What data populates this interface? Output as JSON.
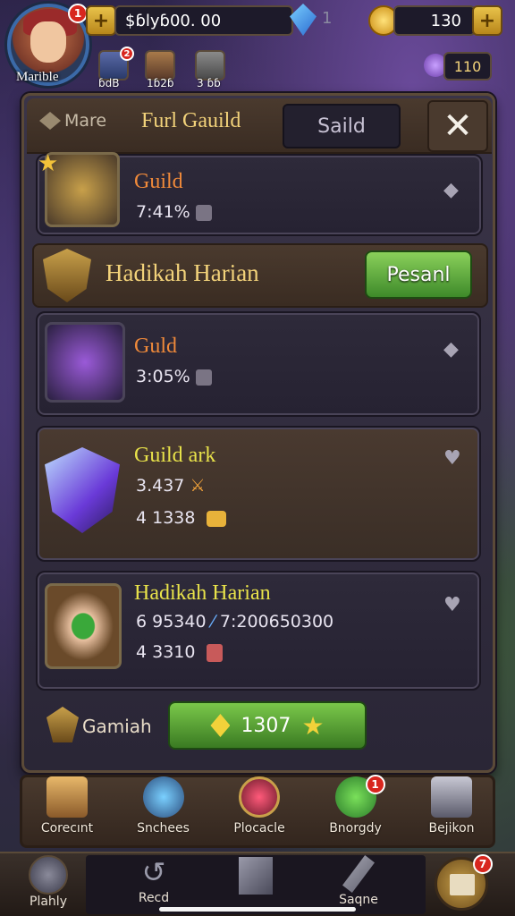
{
  "hud": {
    "player_name": "Marible",
    "avatar_badge": "1",
    "resource_value": "$ɓlyɓ00. 00",
    "gem_count": "1",
    "coin_count": "130",
    "shop_count": "110",
    "heroes": [
      {
        "label": "ɓdB",
        "badge": "2"
      },
      {
        "label": "1ɓ2ɓ"
      },
      {
        "label": "3 ɓɓ"
      }
    ]
  },
  "panel": {
    "tab_icon_label": "Mare",
    "tab_active": "Furl Gauild",
    "tab_inactive": "Saild",
    "close_label": "✕",
    "cards_top": [
      {
        "title": "Guild",
        "value": "7:41%"
      }
    ],
    "section": {
      "title": "Hadikah Harian",
      "button": "Pesanl"
    },
    "cards": [
      {
        "title": "Guld",
        "value": "3:05%"
      },
      {
        "title": "Guild ark",
        "value1": "3.437",
        "value2": "4 1338"
      },
      {
        "title": "Hadikah Harian",
        "value1": "6 95340",
        "value1b": "7:200650300",
        "value2": "4 3310"
      }
    ],
    "footer": {
      "label": "Gamiah",
      "buy_amount": "1307"
    }
  },
  "nav_primary": [
    {
      "label": "Corecınt",
      "icon": "chest-icon"
    },
    {
      "label": "Snchees",
      "icon": "crossbow-icon"
    },
    {
      "label": "Plocacle",
      "icon": "sword-emblem-icon"
    },
    {
      "label": "Bnorgdy",
      "icon": "dragon-icon",
      "badge": "1"
    },
    {
      "label": "Bejikon",
      "icon": "ore-icon"
    }
  ],
  "nav_secondary": [
    {
      "label": "Plahly",
      "icon": "home-icon"
    },
    {
      "label": "Recd",
      "icon": "return-icon"
    },
    {
      "label": "",
      "icon": "cube-icon"
    },
    {
      "label": "Saqne",
      "icon": "feather-icon"
    },
    {
      "label": "",
      "icon": "map-icon",
      "badge": "7"
    }
  ],
  "colors": {
    "accent_gold": "#f2d27a",
    "card_title_orange": "#f08a3a",
    "card_title_yellow": "#e8e24a",
    "button_green": "#5aaa3a"
  }
}
